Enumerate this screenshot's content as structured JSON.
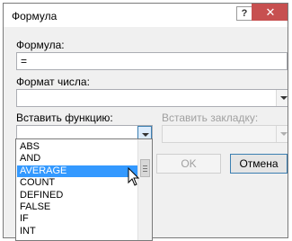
{
  "window": {
    "title": "Формула",
    "help_glyph": "?",
    "close_glyph": "✕"
  },
  "formula": {
    "label": "Формула:",
    "value": "="
  },
  "number_format": {
    "label": "Формат числа:",
    "value": ""
  },
  "paste_function": {
    "label": "Вставить функцию:",
    "value": "",
    "options": [
      "ABS",
      "AND",
      "AVERAGE",
      "COUNT",
      "DEFINED",
      "FALSE",
      "IF",
      "INT"
    ],
    "selected": "AVERAGE"
  },
  "paste_bookmark": {
    "label": "Вставить закладку:",
    "value": ""
  },
  "buttons": {
    "ok": "OK",
    "cancel": "Отмена"
  },
  "colors": {
    "selection": "#3399ff",
    "close_button": "#c75050"
  }
}
